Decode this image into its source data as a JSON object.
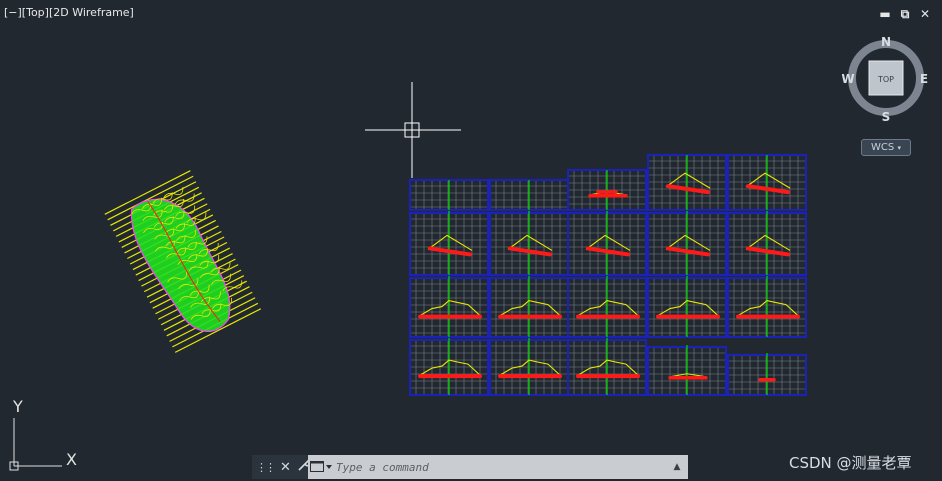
{
  "viewport": {
    "label": "[−][Top][2D Wireframe]"
  },
  "window_controls": {
    "minimize": "▬",
    "restore": "⧉",
    "close": "✕"
  },
  "viewcube": {
    "north": "N",
    "south": "S",
    "east": "E",
    "west": "W",
    "face": "TOP",
    "wcs_label": "WCS"
  },
  "ucs": {
    "x_label": "X",
    "y_label": "Y"
  },
  "command_line": {
    "placeholder": "Type a command",
    "close_glyph": "✕",
    "customize_glyph": "🔧",
    "history_glyph": "▲"
  },
  "watermark": "CSDN @测量老覃",
  "colors": {
    "background": "#212830",
    "grid_frame": "#1a22b8",
    "grid_line": "#7c8088",
    "center_line": "#00d000",
    "terrain": "#e8e800",
    "design": "#ff1a1a",
    "crosshair": "#ffffff"
  },
  "section_sheets": {
    "rows": [
      {
        "sections": [
          "empty",
          "empty",
          "small",
          "peak",
          "peak"
        ]
      },
      {
        "sections": [
          "peak",
          "peak",
          "peak",
          "peak",
          "peak"
        ]
      },
      {
        "sections": [
          "wide",
          "wide",
          "wide",
          "wide",
          "wide"
        ]
      },
      {
        "sections": [
          "wide",
          "wide",
          "wide",
          "small",
          "tiny"
        ]
      }
    ]
  }
}
